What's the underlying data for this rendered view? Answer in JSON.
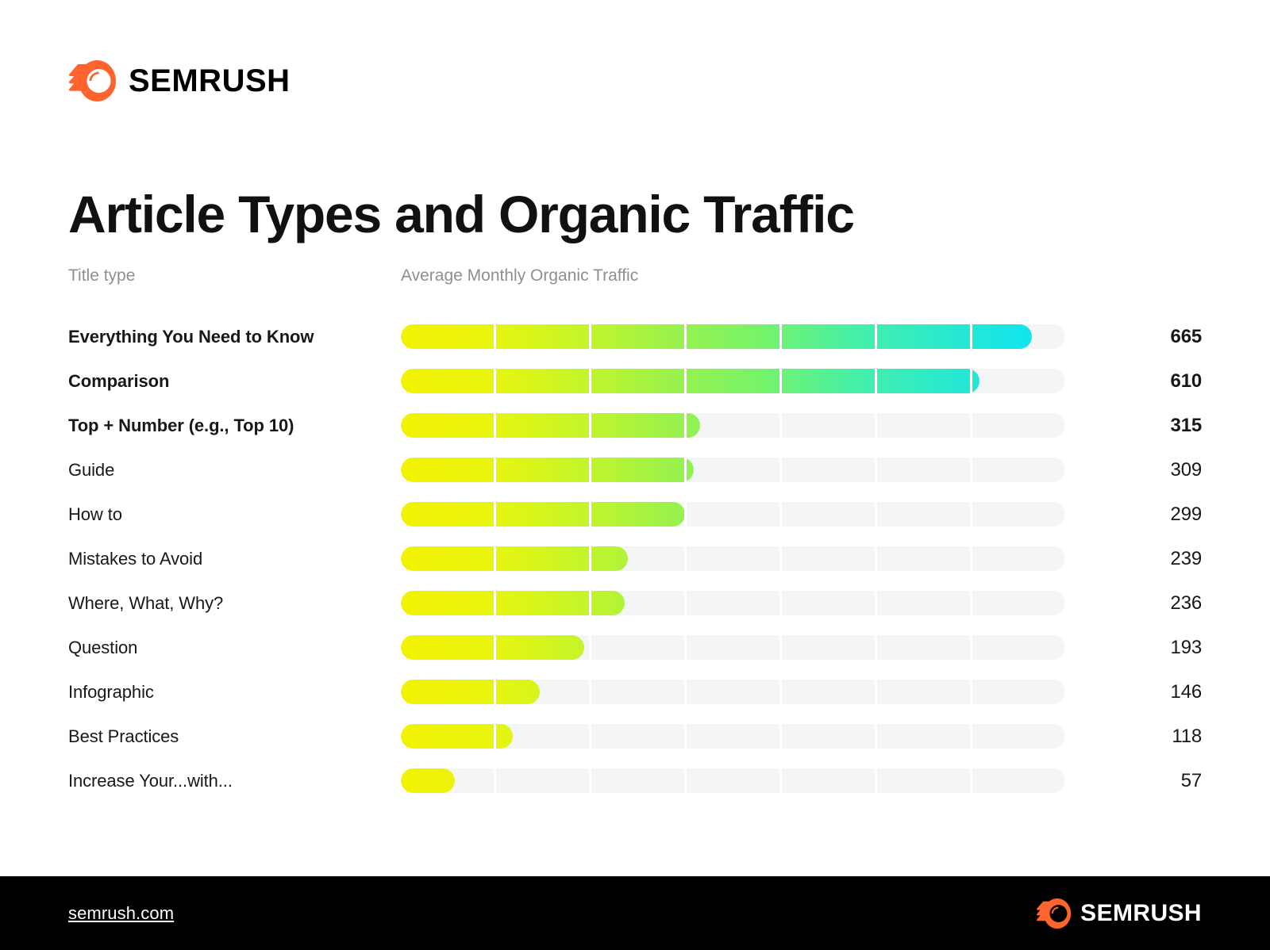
{
  "brand": {
    "name": "SEMRUSH",
    "logo_icon": "semrush-comet-icon",
    "accent_color": "#FF642D"
  },
  "header": {
    "title": "Article Types and Organic Traffic"
  },
  "footer": {
    "link_text": "semrush.com",
    "brand_name": "SEMRUSH",
    "background_color": "#000000"
  },
  "chart_data": {
    "type": "bar",
    "orientation": "horizontal",
    "title": "Article Types and Organic Traffic",
    "xlabel": "Average Monthly Organic Traffic",
    "ylabel": "Title type",
    "column_headers": {
      "label": "Title type",
      "value": "Average Monthly Organic Traffic"
    },
    "xlim": [
      0,
      700
    ],
    "grid": true,
    "gridline_count": 7,
    "legend": "none",
    "gradient": {
      "from": "#F2F205",
      "to": "#10E5F0"
    },
    "track_color": "#F4F6F5",
    "categories": [
      "Everything You Need to Know",
      "Comparison",
      "Top + Number (e.g., Top 10)",
      "Guide",
      "How to",
      "Mistakes to Avoid",
      "Where, What, Why?",
      "Question",
      "Infographic",
      "Best Practices",
      "Increase Your...with..."
    ],
    "values": [
      665,
      610,
      315,
      309,
      299,
      239,
      236,
      193,
      146,
      118,
      57
    ],
    "emphasized": [
      true,
      true,
      true,
      false,
      false,
      false,
      false,
      false,
      false,
      false,
      false
    ],
    "rows": [
      {
        "label": "Everything You Need to Know",
        "value": 665,
        "emphasized": true
      },
      {
        "label": "Comparison",
        "value": 610,
        "emphasized": true
      },
      {
        "label": "Top + Number (e.g., Top 10)",
        "value": 315,
        "emphasized": true
      },
      {
        "label": "Guide",
        "value": 309,
        "emphasized": false
      },
      {
        "label": "How to",
        "value": 299,
        "emphasized": false
      },
      {
        "label": "Mistakes to Avoid",
        "value": 239,
        "emphasized": false
      },
      {
        "label": "Where, What, Why?",
        "value": 236,
        "emphasized": false
      },
      {
        "label": "Question",
        "value": 193,
        "emphasized": false
      },
      {
        "label": "Infographic",
        "value": 146,
        "emphasized": false
      },
      {
        "label": "Best Practices",
        "value": 118,
        "emphasized": false
      },
      {
        "label": "Increase Your...with...",
        "value": 57,
        "emphasized": false
      }
    ]
  }
}
